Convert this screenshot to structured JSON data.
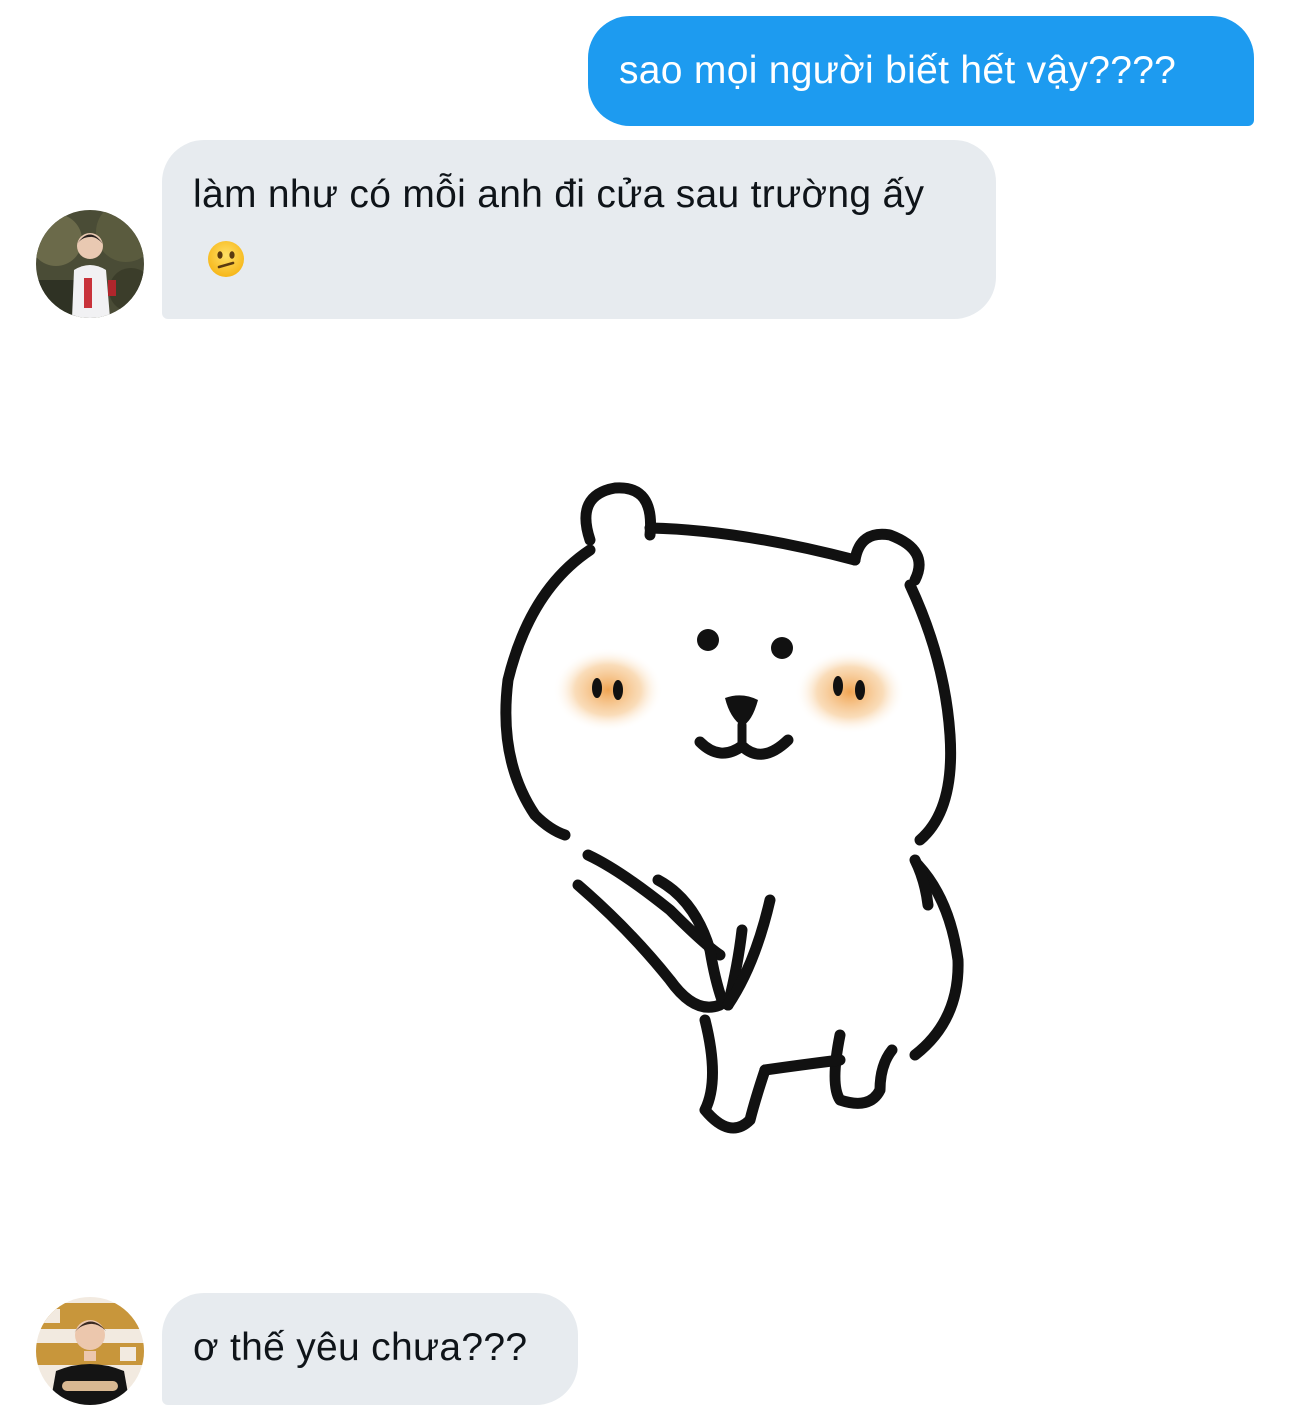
{
  "conversation": {
    "messages": [
      {
        "sender": "me",
        "text": "sao mọi người biết hết vậy????"
      },
      {
        "sender": "other",
        "text": "làm như có mỗi anh đi cửa sau trường ấy",
        "emoji": "confused-face"
      },
      {
        "sender": "other",
        "sticker": "white-bear-sticker"
      },
      {
        "sender": "other",
        "text": "ơ thế yêu chưa???"
      }
    ]
  },
  "colors": {
    "sent_bubble": "#1d9bf0",
    "received_bubble": "#e7ebef",
    "received_text": "#0f1419",
    "sent_text": "#ffffff"
  }
}
